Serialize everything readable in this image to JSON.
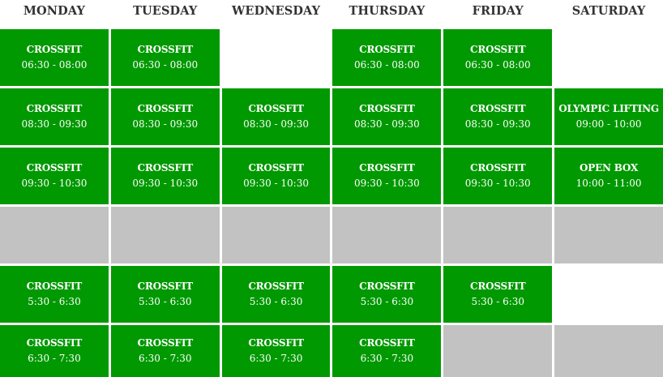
{
  "days": [
    "MONDAY",
    "TUESDAY",
    "WEDNESDAY",
    "THURSDAY",
    "FRIDAY",
    "SATURDAY"
  ],
  "rows": [
    [
      {
        "state": "green",
        "cls": "CROSSFIT",
        "time": "06:30 - 08:00"
      },
      {
        "state": "green",
        "cls": "CROSSFIT",
        "time": "06:30 - 08:00"
      },
      {
        "state": "empty"
      },
      {
        "state": "green",
        "cls": "CROSSFIT",
        "time": "06:30 - 08:00"
      },
      {
        "state": "green",
        "cls": "CROSSFIT",
        "time": "06:30 - 08:00"
      },
      {
        "state": "empty"
      }
    ],
    [
      {
        "state": "green",
        "cls": "CROSSFIT",
        "time": "08:30 - 09:30"
      },
      {
        "state": "green",
        "cls": "CROSSFIT",
        "time": "08:30 - 09:30"
      },
      {
        "state": "green",
        "cls": "CROSSFIT",
        "time": "08:30 - 09:30"
      },
      {
        "state": "green",
        "cls": "CROSSFIT",
        "time": "08:30 - 09:30"
      },
      {
        "state": "green",
        "cls": "CROSSFIT",
        "time": "08:30 - 09:30"
      },
      {
        "state": "green",
        "cls": "OLYMPIC LIFTING",
        "time": "09:00 - 10:00"
      }
    ],
    [
      {
        "state": "green",
        "cls": "CROSSFIT",
        "time": "09:30 - 10:30"
      },
      {
        "state": "green",
        "cls": "CROSSFIT",
        "time": "09:30 - 10:30"
      },
      {
        "state": "green",
        "cls": "CROSSFIT",
        "time": "09:30 - 10:30"
      },
      {
        "state": "green",
        "cls": "CROSSFIT",
        "time": "09:30 - 10:30"
      },
      {
        "state": "green",
        "cls": "CROSSFIT",
        "time": "09:30 - 10:30"
      },
      {
        "state": "green",
        "cls": "OPEN BOX",
        "time": "10:00 - 11:00"
      }
    ],
    [
      {
        "state": "gray"
      },
      {
        "state": "gray"
      },
      {
        "state": "gray"
      },
      {
        "state": "gray"
      },
      {
        "state": "gray"
      },
      {
        "state": "gray"
      }
    ],
    [
      {
        "state": "green",
        "cls": "CROSSFIT",
        "time": "5:30 - 6:30"
      },
      {
        "state": "green",
        "cls": "CROSSFIT",
        "time": "5:30 - 6:30"
      },
      {
        "state": "green",
        "cls": "CROSSFIT",
        "time": "5:30 - 6:30"
      },
      {
        "state": "green",
        "cls": "CROSSFIT",
        "time": "5:30 - 6:30"
      },
      {
        "state": "green",
        "cls": "CROSSFIT",
        "time": "5:30 - 6:30"
      },
      {
        "state": "empty"
      }
    ],
    [
      {
        "state": "green",
        "cls": "CROSSFIT",
        "time": "6:30 - 7:30"
      },
      {
        "state": "green",
        "cls": "CROSSFIT",
        "time": "6:30 - 7:30"
      },
      {
        "state": "green",
        "cls": "CROSSFIT",
        "time": "6:30 - 7:30"
      },
      {
        "state": "green",
        "cls": "CROSSFIT",
        "time": "6:30 - 7:30"
      },
      {
        "state": "gray"
      },
      {
        "state": "gray"
      }
    ]
  ],
  "colors": {
    "session": "#019901",
    "blocked": "#c2c2c2",
    "text": "#ffffff",
    "header": "#333333"
  }
}
